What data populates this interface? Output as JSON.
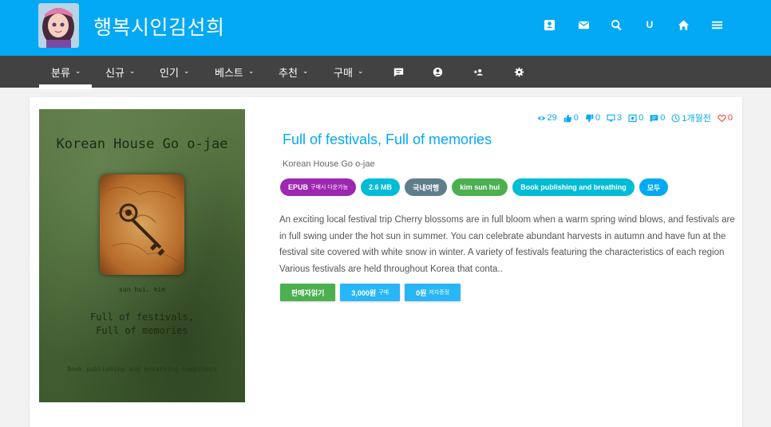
{
  "header": {
    "site_title": "행복시인김선희",
    "user_initial": "U",
    "icons": [
      "contact-icon",
      "mail-icon",
      "search-icon",
      "user-icon",
      "home-icon",
      "menu-icon"
    ]
  },
  "nav": {
    "items": [
      {
        "label": "분류",
        "dropdown": true
      },
      {
        "label": "신규",
        "dropdown": true
      },
      {
        "label": "인기",
        "dropdown": true
      },
      {
        "label": "베스트",
        "dropdown": true
      },
      {
        "label": "추천",
        "dropdown": true
      },
      {
        "label": "구매",
        "dropdown": true
      }
    ],
    "icon_items": [
      "comment-icon",
      "account-icon",
      "follow-icon",
      "settings-icon"
    ],
    "chevron": "⌄"
  },
  "book": {
    "cover": {
      "title": "Korean House Go o-jae",
      "author": "sun hui, kim",
      "subtitle_line1": "Full of festivals,",
      "subtitle_line2": "Full of memories",
      "publisher": "Book publishing and breathing happiness"
    },
    "stats": {
      "views": "29",
      "likes": "0",
      "dislikes": "0",
      "screens": "3",
      "downloads": "0",
      "comments": "0",
      "time": "1개월전",
      "hearts": "0"
    },
    "title": "Full of festivals, Full of memories",
    "author": "Korean House Go o-jae",
    "tags": [
      {
        "label": "EPUB",
        "sub": "구매시 다운가능",
        "color": "#9c27b0"
      },
      {
        "label": "2.6 MB",
        "sub": "",
        "color": "#00bcd4"
      },
      {
        "label": "국내여행",
        "sub": "",
        "color": "#607d8b"
      },
      {
        "label": "kim sun hui",
        "sub": "",
        "color": "#4caf50"
      },
      {
        "label": "Book publishing and breathing",
        "sub": "",
        "color": "#00bcd4"
      },
      {
        "label": "모두",
        "sub": "",
        "color": "#03a9f4"
      }
    ],
    "description": "An exciting local festival trip Cherry blossoms are in full bloom when a warm spring wind blows, and festivals are in full swing under the hot sun in summer. You can celebrate abundant harvests in autumn and have fun at the festival site covered with white snow in winter. A variety of festivals featuring the characteristics of each region Various festivals are held throughout Korea that conta..",
    "buttons": [
      {
        "label": "판매자읽기",
        "sub": "",
        "color": "#4caf50"
      },
      {
        "label": "3,000원",
        "sub": "구매",
        "color": "#29b6f6"
      },
      {
        "label": "0원",
        "sub": "저자증정",
        "color": "#29b6f6"
      }
    ]
  },
  "colors": {
    "header_bg": "#03a9f4",
    "nav_bg": "#424242",
    "accent": "#03a9f4",
    "heart": "#f44336"
  }
}
